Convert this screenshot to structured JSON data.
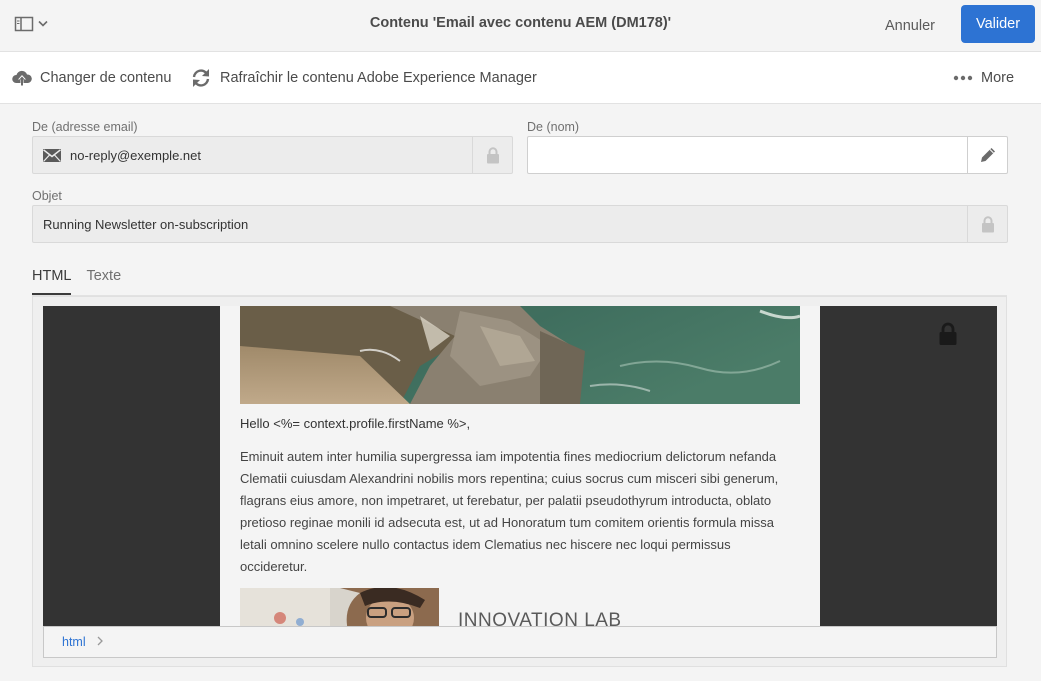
{
  "header": {
    "title": "Contenu 'Email avec contenu AEM (DM178)'",
    "cancel_label": "Annuler",
    "validate_label": "Valider",
    "accent_color": "#2d73d3"
  },
  "actions": {
    "change_content": "Changer de contenu",
    "refresh_aem": "Rafraîchir le contenu Adobe Experience Manager",
    "more": "More"
  },
  "form": {
    "from_email": {
      "label": "De (adresse email)",
      "value": "no-reply@exemple.net",
      "icon": "envelope-icon",
      "locked": true
    },
    "from_name": {
      "label": "De (nom)",
      "value": "",
      "icon": "pencil-icon"
    },
    "subject": {
      "label": "Objet",
      "value": "Running Newsletter on-subscription",
      "locked": true
    }
  },
  "tabs": [
    {
      "label": "HTML",
      "active": true
    },
    {
      "label": "Texte",
      "active": false
    }
  ],
  "email_preview": {
    "greeting": "Hello <%= context.profile.firstName %>,",
    "paragraph": "Eminuit autem inter humilia supergressa iam impotentia fines mediocrium delictorum nefanda Clematii cuiusdam Alexandrini nobilis mors repentina; cuius socrus cum misceri sibi generum, flagrans eius amore, non impetraret, ut ferebatur, per palatii pseudothyrum introducta, oblato pretioso reginae monili id adsecuta est, ut ad Honoratum tum comitem orientis formula missa letali omnino scelere nullo contactus idem Clematius nec hiscere nec loqui permissus occideretur.",
    "section_title": "INNOVATION LAB",
    "locked": true
  },
  "breadcrumb": {
    "items": [
      "html"
    ]
  }
}
